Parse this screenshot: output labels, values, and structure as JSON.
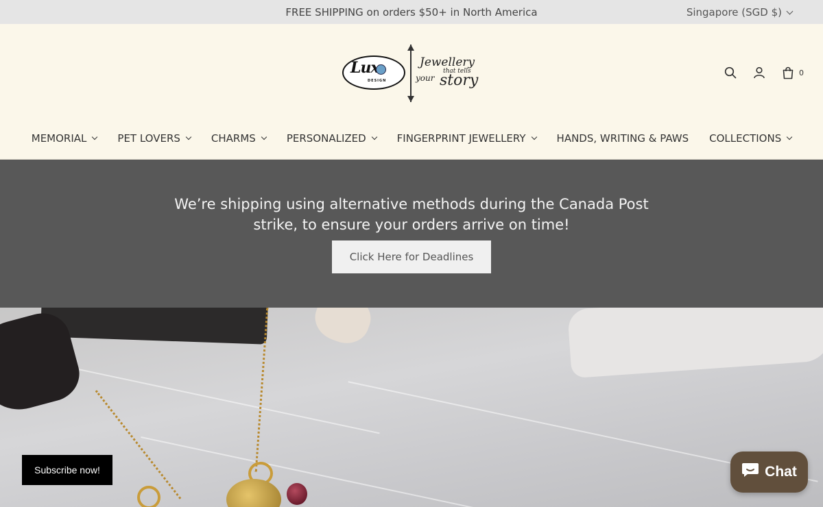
{
  "topbar": {
    "promo": "FREE SHIPPING on orders $50+ in North America",
    "currency": "Singapore (SGD $)"
  },
  "logo": {
    "brand": "Lux",
    "brand_sub": "DESIGN",
    "tagline_1": "Jewellery",
    "tagline_2": "that tells",
    "tagline_3": "your",
    "tagline_4": "story"
  },
  "header": {
    "cart_count": "0",
    "icons": [
      "search-icon",
      "account-icon",
      "cart-icon"
    ]
  },
  "nav": {
    "items": [
      {
        "label": "MEMORIAL",
        "has_dropdown": true
      },
      {
        "label": "PET LOVERS",
        "has_dropdown": true
      },
      {
        "label": "CHARMS",
        "has_dropdown": true
      },
      {
        "label": "PERSONALIZED",
        "has_dropdown": true
      },
      {
        "label": "FINGERPRINT JEWELLERY",
        "has_dropdown": true
      },
      {
        "label": "HANDS, WRITING & PAWS",
        "has_dropdown": false
      },
      {
        "label": "COLLECTIONS",
        "has_dropdown": true
      }
    ]
  },
  "announcement": {
    "message": "We’re shipping using alternative methods during the Canada Post strike, to ensure your orders arrive on time!",
    "button": "Click Here for Deadlines"
  },
  "subscribe": {
    "label": "Subscribe now!"
  },
  "chat": {
    "label": "Chat"
  },
  "colors": {
    "topbar_bg": "#e5e5e5",
    "header_bg": "#fbf7ea",
    "announcement_bg": "#585858",
    "chat_bg": "#614f3c"
  }
}
